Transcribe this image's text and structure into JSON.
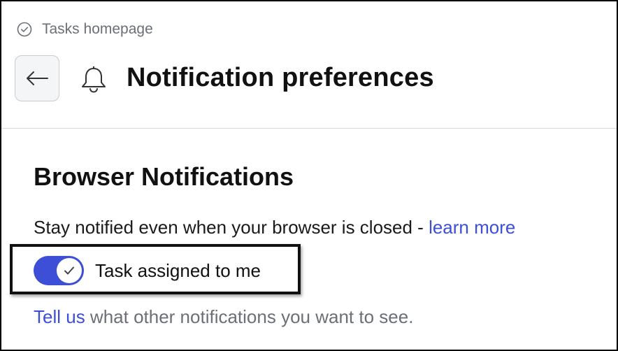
{
  "header": {
    "breadcrumb_label": "Tasks homepage",
    "title": "Notification preferences",
    "icons": {
      "breadcrumb": "check-circle-icon",
      "back": "arrow-left-icon",
      "title": "bell-icon"
    }
  },
  "section": {
    "title": "Browser Notifications",
    "description": "Stay notified even when your browser is closed - ",
    "learn_more_link": "learn more",
    "toggles": [
      {
        "label": "Task assigned to me",
        "checked": true,
        "icon": "check-icon"
      }
    ],
    "footer_link": "Tell us",
    "footer_text": " what other notifications you want to see."
  },
  "colors": {
    "accent": "#3d4fd6",
    "muted_text": "#6b6f76",
    "highlight_border": "#111111"
  }
}
